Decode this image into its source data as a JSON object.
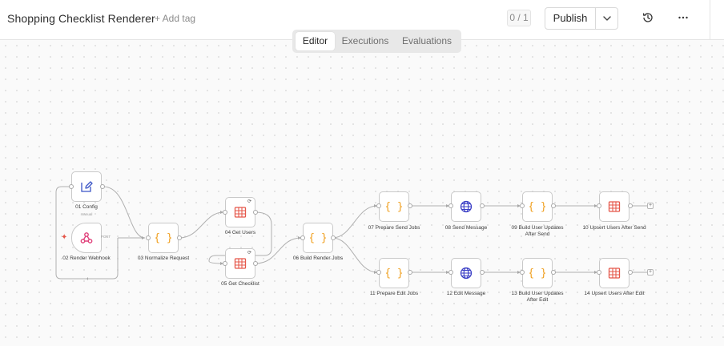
{
  "header": {
    "title": "Shopping Checklist Renderer",
    "add_tag": "+ Add tag",
    "counter": "0 / 1",
    "publish": "Publish"
  },
  "tabs": [
    {
      "label": "Editor",
      "active": true
    },
    {
      "label": "Executions",
      "active": false
    },
    {
      "label": "Evaluations",
      "active": false
    }
  ],
  "nodes": {
    "n01": {
      "label": "01 Config",
      "sub": "manual",
      "icon": "edit-icon"
    },
    "n02": {
      "label": "02 Render Webhook",
      "sub": "POST",
      "icon": "webhook-icon"
    },
    "n03": {
      "label": "03 Normalize Request",
      "icon": "code-braces-icon"
    },
    "n04": {
      "label": "04 Get Users",
      "icon": "table-icon"
    },
    "n05": {
      "label": "05 Get Checklist",
      "icon": "table-icon"
    },
    "n06": {
      "label": "06 Build Render Jobs",
      "icon": "code-braces-icon"
    },
    "n07": {
      "label": "07 Prepare Send Jobs",
      "icon": "code-braces-icon"
    },
    "n08": {
      "label": "08 Send Message",
      "icon": "globe-icon"
    },
    "n09": {
      "label": "09 Build User Updates After Send",
      "icon": "code-braces-icon"
    },
    "n10": {
      "label": "10 Upsert Users After Send",
      "icon": "table-icon"
    },
    "n11": {
      "label": "11 Prepare Edit Jobs",
      "icon": "code-braces-icon"
    },
    "n12": {
      "label": "12 Edit Message",
      "icon": "globe-icon"
    },
    "n13": {
      "label": "13 Build User Updates After Edit",
      "icon": "code-braces-icon"
    },
    "n14": {
      "label": "14 Upsert Users After Edit",
      "icon": "table-icon"
    }
  },
  "colors": {
    "code": "#f0a020",
    "table": "#e5574a",
    "globe": "#3b3fc6",
    "webhook": "#e0407a",
    "edit": "#3b55c6"
  }
}
